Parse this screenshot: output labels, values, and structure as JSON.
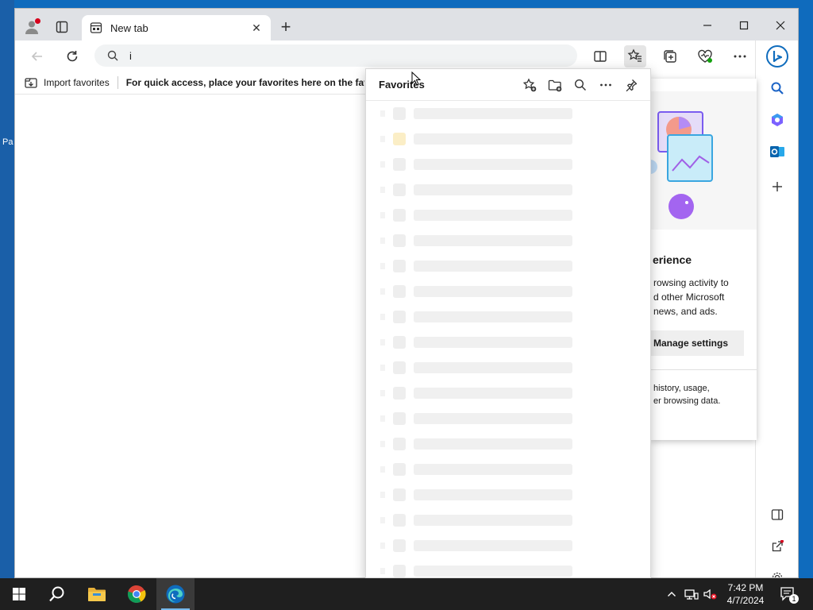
{
  "desktop": {
    "label": "Pa"
  },
  "tab": {
    "title": "New tab"
  },
  "address": {
    "value": "i"
  },
  "favorites_bar": {
    "import_label": "Import favorites",
    "hint": "For quick access, place your favorites here on the favorites bar."
  },
  "flyout": {
    "title": "Favorites"
  },
  "info_card": {
    "heading": "erience",
    "line1": "rowsing activity to",
    "line2": "d other Microsoft",
    "line3": "news, and ads.",
    "manage_label": "Manage settings",
    "line4": "history, usage,",
    "line5": "er browsing data."
  },
  "clock": {
    "time": "7:42 PM",
    "date": "4/7/2024"
  },
  "notifications": {
    "count": "1"
  },
  "colors": {
    "edge_accent": "#0f6cbd",
    "taskbar": "#1f1f1f",
    "alert_red": "#d6001c"
  }
}
